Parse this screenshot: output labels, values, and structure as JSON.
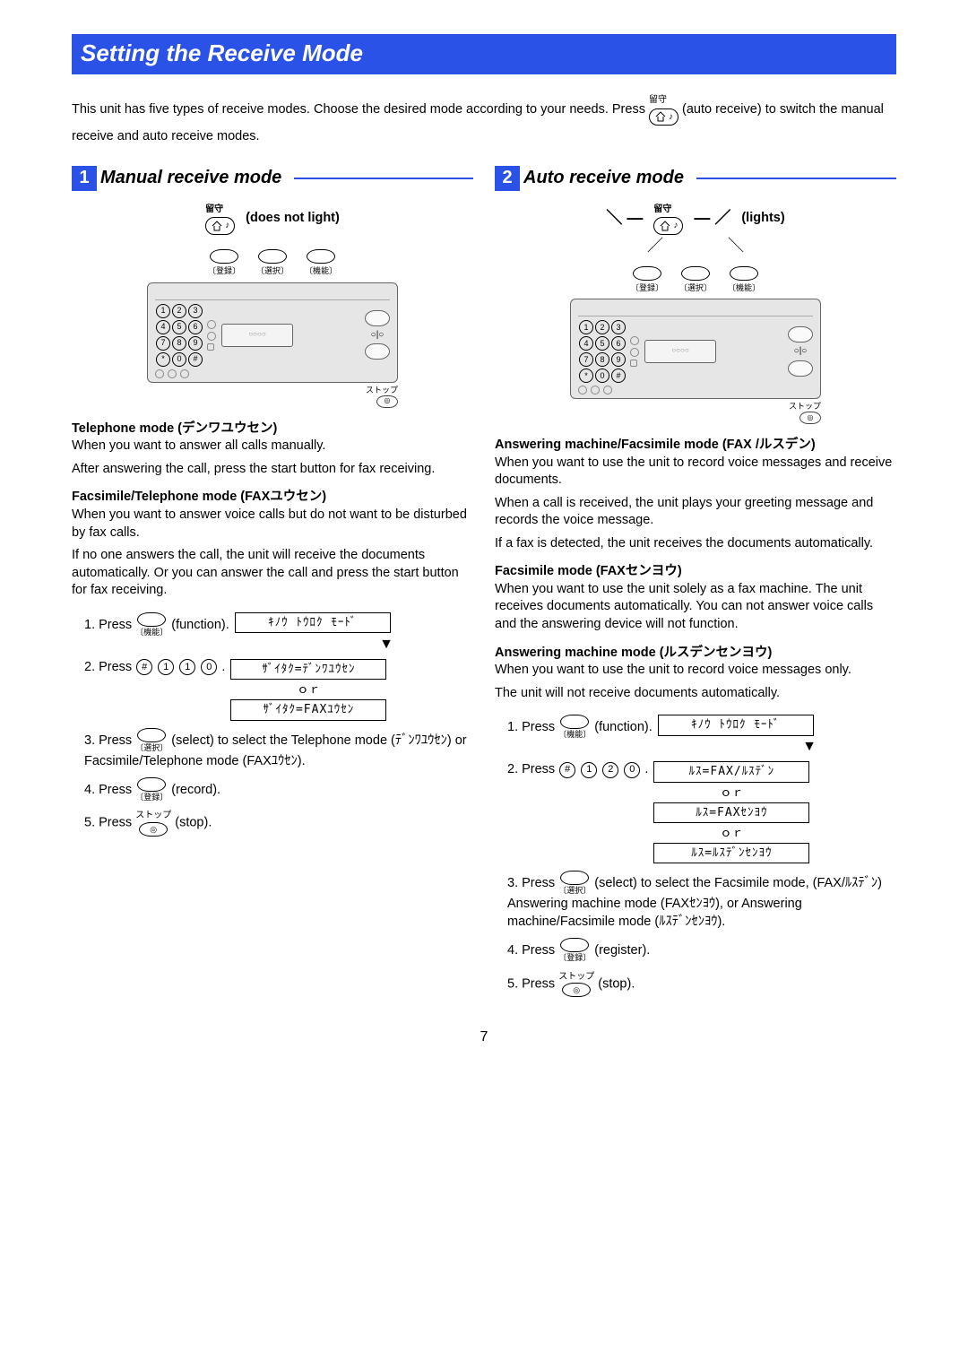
{
  "title": "Setting the Receive Mode",
  "intro": "This unit has five types of receive modes. Choose the desired mode according to your needs. Press ",
  "intro_tail": " (auto receive) to switch the manual receive and auto receive modes.",
  "rusu_label": "留守",
  "stop_label": "ストップ",
  "sections": [
    {
      "num": "1",
      "title": "Manual receive mode",
      "status_note": "(does not light)"
    },
    {
      "num": "2",
      "title": "Auto receive mode",
      "status_note": "(lights)"
    }
  ],
  "panel_btns": [
    "〔登録〕",
    "〔選択〕",
    "〔機能〕"
  ],
  "left": {
    "h1": "Telephone mode (デンワユウセン)",
    "p1a": "When you want to answer all calls manually.",
    "p1b": "After answering the call, press the start button for fax receiving.",
    "h2": "Facsimile/Telephone mode (FAXユウセン)",
    "p2a": "When you want to answer voice calls but do not want to be disturbed by fax calls.",
    "p2b": "If no one answers the call, the unit will receive the documents automatically. Or you can answer the call and press the start button for fax receiving.",
    "steps": {
      "s1_prefix": "1. Press ",
      "s1_key_label": "〔機能〕",
      "s1_suffix": " (function).",
      "s1_lcd": "ｷﾉｳ ﾄｳﾛｸ ﾓｰﾄﾞ",
      "s2_prefix": "2. Press ",
      "s2_digits": [
        "#",
        "1",
        "1",
        "0"
      ],
      "s2_lcd1": "ｻﾞｲﾀｸ=ﾃﾞﾝﾜﾕｳｾﾝ",
      "or": "ｏｒ",
      "s2_lcd2": "ｻﾞｲﾀｸ=FAXﾕｳｾﾝ",
      "s3_prefix": "3. Press ",
      "s3_key_label": "〔選択〕",
      "s3_mid": " (select) to select the Telephone mode (ﾃﾞﾝﾜﾕｳｾﾝ) or Facsimile/Telephone mode (FAXﾕｳｾﾝ).",
      "s4_prefix": "4. Press ",
      "s4_key_label": "〔登録〕",
      "s4_suffix": " (record).",
      "s5_prefix": "5. Press ",
      "s5_suffix": " (stop)."
    }
  },
  "right": {
    "h1": "Answering machine/Facsimile mode (FAX /ルスデン)",
    "p1a": "When you want to use the unit to record voice messages and receive documents.",
    "p1b": "When a call is received, the unit plays your greeting message and records the voice message.",
    "p1c": "If a fax is detected, the unit receives the documents automatically.",
    "h2": "Facsimile mode (FAXセンヨウ)",
    "p2a": "When you want to use the unit solely as a fax machine. The unit receives documents automatically. You can not answer voice calls and the answering device will not function.",
    "h3": "Answering machine mode (ルスデンセンヨウ)",
    "p3a": "When you want to use the unit to record voice messages only.",
    "p3b": "The unit will not receive documents automatically.",
    "steps": {
      "s1_prefix": "1. Press ",
      "s1_key_label": "〔機能〕",
      "s1_suffix": " (function).",
      "s1_lcd": "ｷﾉｳ ﾄｳﾛｸ ﾓｰﾄﾞ",
      "s2_prefix": "2. Press ",
      "s2_digits": [
        "#",
        "1",
        "2",
        "0"
      ],
      "s2_lcd1": "ﾙｽ=FAX/ﾙｽﾃﾞﾝ",
      "or": "ｏｒ",
      "s2_lcd2": "ﾙｽ=FAXｾﾝﾖｳ",
      "s2_lcd3": "ﾙｽ=ﾙｽﾃﾞﾝｾﾝﾖｳ",
      "s3_prefix": "3. Press ",
      "s3_key_label": "〔選択〕",
      "s3_mid": " (select) to select the Facsimile mode, (FAX/ﾙｽﾃﾞﾝ) Answering machine mode (FAXｾﾝﾖｳ), or Answering machine/Facsimile mode (ﾙｽﾃﾞﾝｾﾝﾖｳ).",
      "s4_prefix": "4. Press ",
      "s4_key_label": "〔登録〕",
      "s4_suffix": " (register).",
      "s5_prefix": "5. Press ",
      "s5_suffix": " (stop)."
    }
  },
  "page_number": "7"
}
